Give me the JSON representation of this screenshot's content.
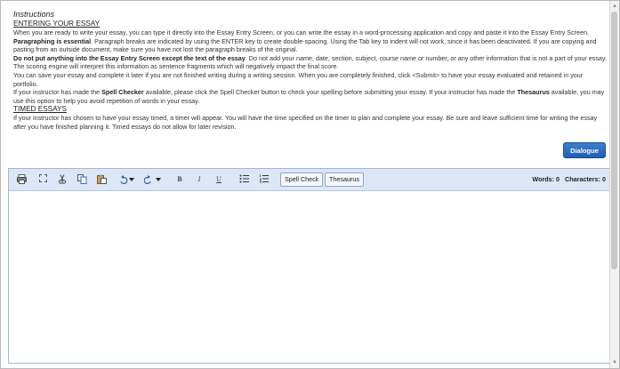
{
  "instructions": {
    "title": "Instructions",
    "entering_heading": "ENTERING YOUR ESSAY",
    "p1": "When you are ready to write your essay, you can type it directly into the Essay Entry Screen, or you can write the essay in a word-processing application and copy and paste it into the Essay Entry Screen.",
    "p2_bold": "Paragraphing is essential",
    "p2": ". Paragraph breaks are indicated by using the ENTER key to create double-spacing. Using the Tab key to indent will not work, since it has been deactivated. If you are copying and pasting from an outside document, make sure you have not lost the paragraph breaks of the original.",
    "p3_bold": "Do not put anything into the Essay Entry Screen except the text of the essay",
    "p3": ". Do not add your name, date, section, subject, course name or number, or any other information that is not a part of your essay. The scoring engine will interpret this information as sentence fragments which will negatively impact the final score.",
    "p4": "You can save your essay and complete it later if you are not finished writing during a writing session. When you are completely finished, click <Submit> to have your essay evaluated and retained in your portfolio.",
    "p5_a": "If your instructor has made the ",
    "p5_bold1": "Spell Checker",
    "p5_b": " available, please click the Spell Checker button to check your spelling before submitting your essay. If your instructor has made the ",
    "p5_bold2": "Thesaurus",
    "p5_c": " available, you may use this option to help you avoid repetition of words in your essay.",
    "timed_heading": "TIMED ESSAYS",
    "p6": "If your instructor has chosen to have your essay timed, a timer will appear. You will have the time specified on the timer to plan and complete your essay. Be sure and leave sufficient time for writing the essay after you have finished planning it. Timed essays do not allow for later revision."
  },
  "dialogue_button": "Dialogue",
  "toolbar": {
    "spell_check": "Spell Check",
    "thesaurus": "Thesaurus",
    "icons": [
      "print-icon",
      "fullscreen-icon",
      "cut-icon",
      "copy-icon",
      "paste-icon",
      "undo-icon",
      "redo-icon",
      "bold-icon",
      "italic-icon",
      "underline-icon",
      "bullet-list-icon",
      "numbered-list-icon"
    ]
  },
  "counts": {
    "words_label": "Words:",
    "words_value": "0",
    "characters_label": "Characters:",
    "characters_value": "0"
  },
  "editor": {
    "value": ""
  }
}
